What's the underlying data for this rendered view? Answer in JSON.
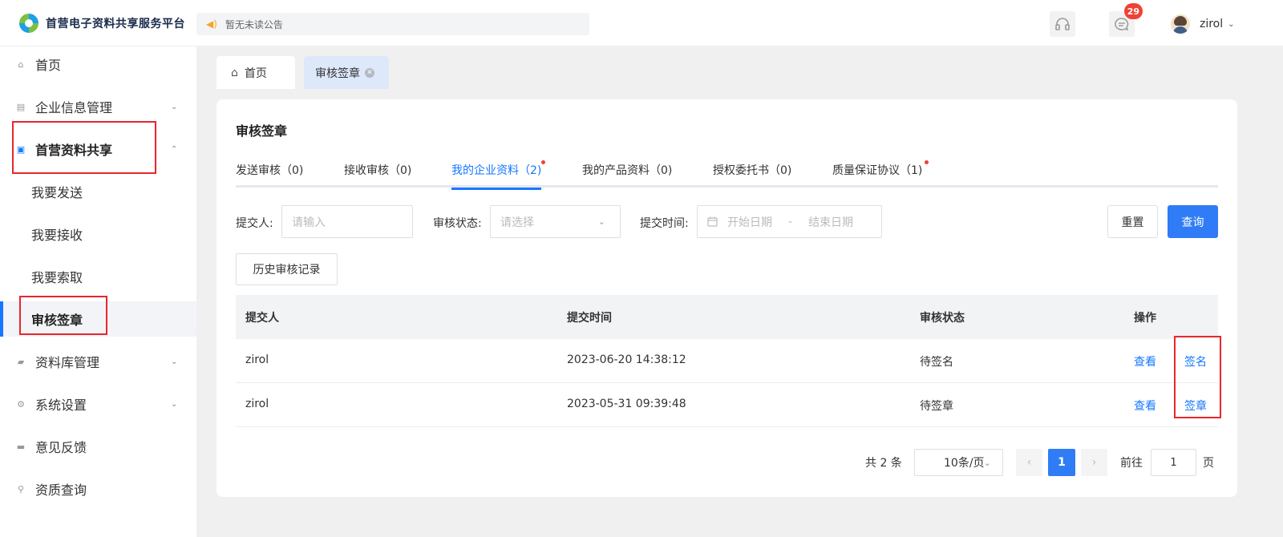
{
  "header": {
    "logo_text": "首营电子资料共享服务平台",
    "notice": "暂无未读公告",
    "message_badge": "29",
    "user_name": "zirol"
  },
  "sidebar": {
    "items": [
      {
        "label": "首页",
        "icon": "home-icon"
      },
      {
        "label": "企业信息管理",
        "icon": "file-icon"
      },
      {
        "label": "首营资料共享",
        "icon": "share-folder-icon"
      },
      {
        "label": "我要发送"
      },
      {
        "label": "我要接收"
      },
      {
        "label": "我要索取"
      },
      {
        "label": "审核签章"
      },
      {
        "label": "资料库管理",
        "icon": "folder-icon"
      },
      {
        "label": "系统设置",
        "icon": "gear-icon"
      },
      {
        "label": "意见反馈",
        "icon": "feedback-icon"
      },
      {
        "label": "资质查询",
        "icon": "search-icon"
      }
    ]
  },
  "breadcrumb": {
    "home": "首页",
    "current": "审核签章"
  },
  "page": {
    "title": "审核签章",
    "tabs": [
      {
        "label": "发送审核（0)"
      },
      {
        "label": "接收审核（0)"
      },
      {
        "label": "我的企业资料（2)"
      },
      {
        "label": "我的产品资料（0)"
      },
      {
        "label": "授权委托书（0)"
      },
      {
        "label": "质量保证协议（1)"
      }
    ],
    "active_tab": "我的企业资料（2)"
  },
  "filters": {
    "submitter_label": "提交人:",
    "submitter_placeholder": "请输入",
    "status_label": "审核状态:",
    "status_placeholder": "请选择",
    "time_label": "提交时间:",
    "start_placeholder": "开始日期",
    "range_sep": "-",
    "end_placeholder": "结束日期",
    "reset": "重置",
    "query": "查询",
    "history": "历史审核记录"
  },
  "table": {
    "columns": [
      "提交人",
      "提交时间",
      "审核状态",
      "操作"
    ],
    "rows": [
      {
        "submitter": "zirol",
        "time": "2023-06-20 14:38:12",
        "status": "待签名",
        "view": "查看",
        "action": "签名"
      },
      {
        "submitter": "zirol",
        "time": "2023-05-31 09:39:48",
        "status": "待签章",
        "view": "查看",
        "action": "签章"
      }
    ]
  },
  "pagination": {
    "total": "共 2 条",
    "page_size": "10条/页",
    "current_page": "1",
    "goto_label": "前往",
    "goto_value": "1",
    "goto_unit": "页"
  },
  "colors": {
    "primary": "#2f7cf6",
    "link": "#1677ff",
    "highlight_box": "#e8262d",
    "badge": "#f04134"
  }
}
